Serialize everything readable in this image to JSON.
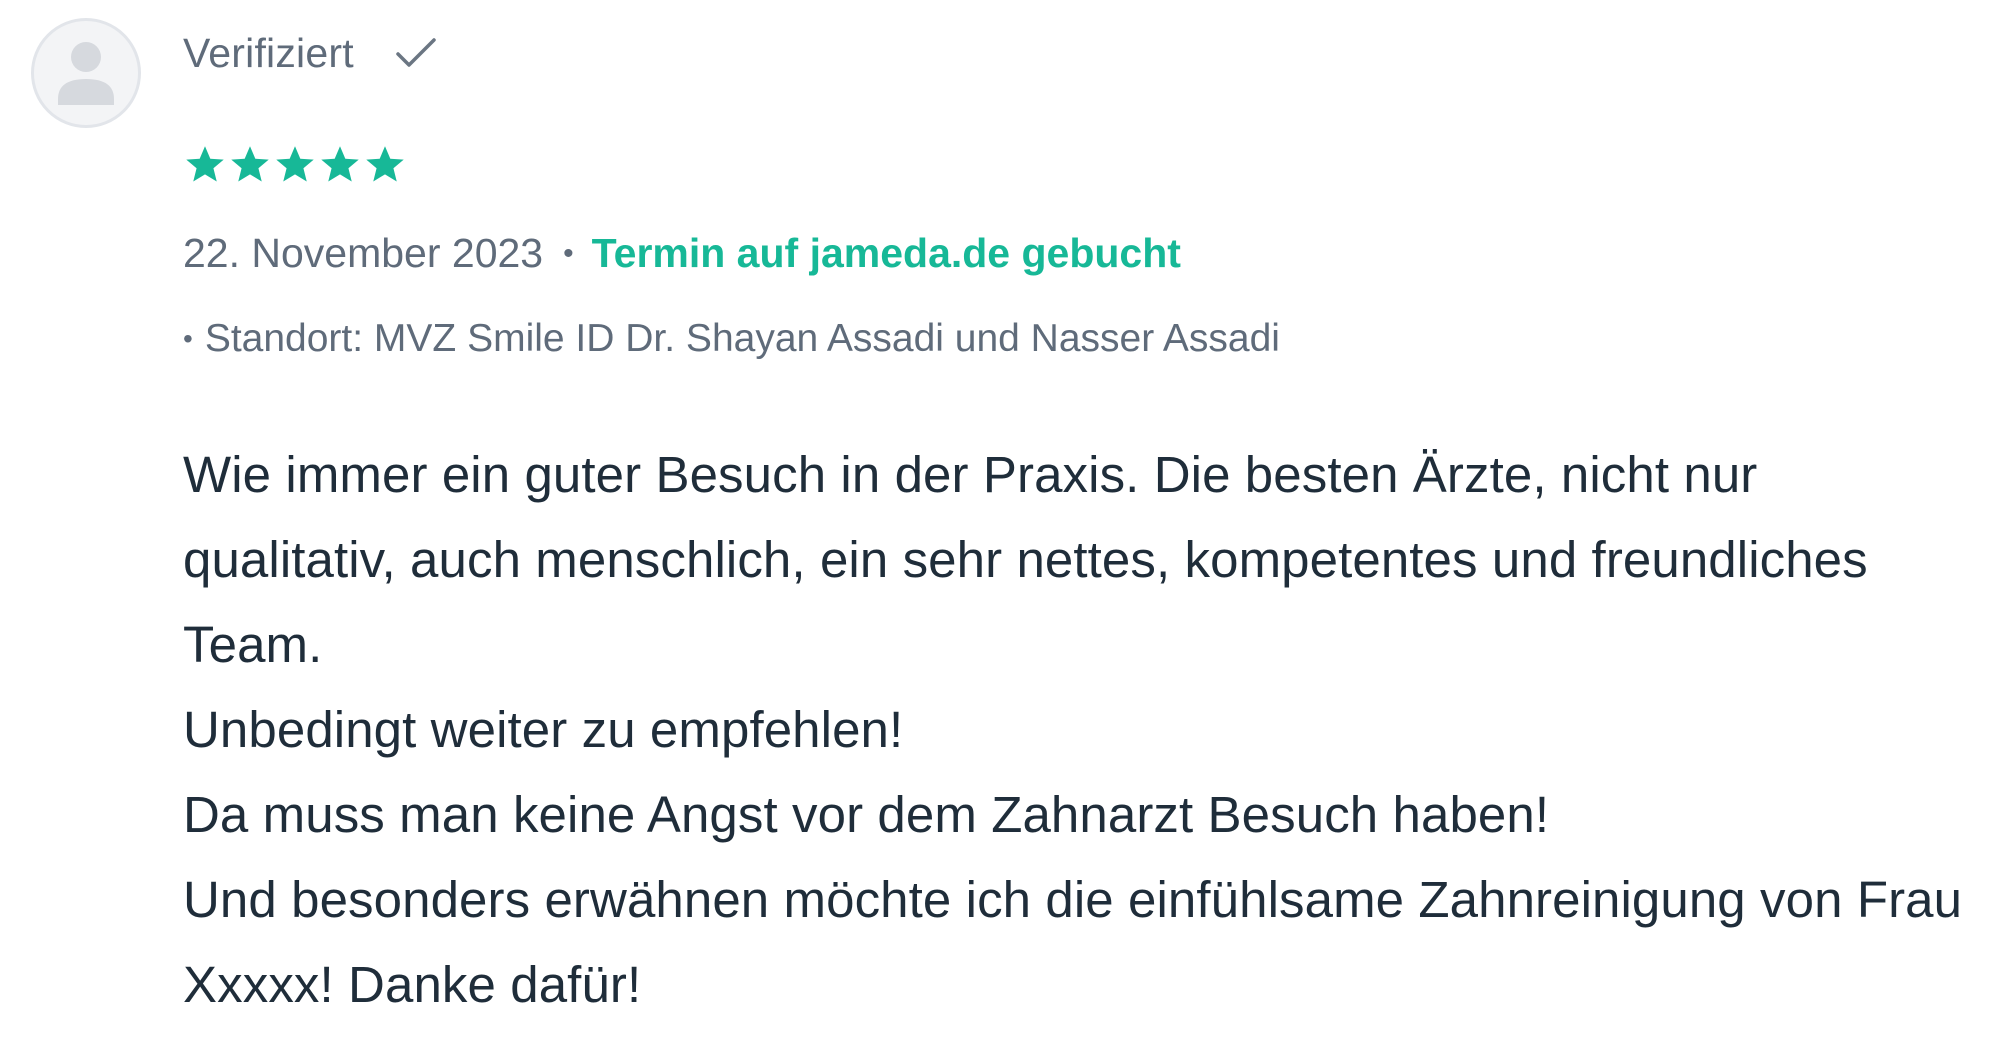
{
  "review": {
    "verified_label": "Verifiziert",
    "rating": 5,
    "rating_max": 5,
    "date": "22. November 2023",
    "separator": "•",
    "booking_note": "Termin auf jameda.de gebucht",
    "location_bullet": "•",
    "location": "Standort: MVZ Smile ID Dr. Shayan Assadi und Nasser Assadi",
    "text": "Wie immer ein guter Besuch in der Praxis. Die besten Ärzte, nicht nur qualitativ, auch menschlich, ein sehr nettes, kompetentes und freundliches Team.\nUnbedingt weiter zu empfehlen!\nDa muss man keine Angst vor dem Zahnarzt Besuch haben!\nUnd besonders erwähnen möchte ich die einfühlsame Zahnreinigung von Frau Xxxxx! Danke dafür!"
  },
  "icons": {
    "avatar": "user-avatar-icon",
    "verified": "check-icon",
    "star": "star-icon"
  },
  "colors": {
    "accent_green": "#17b897",
    "meta_gray": "#5f6b7a",
    "body_text": "#1f2d3a",
    "avatar_bg": "#f3f4f6"
  }
}
